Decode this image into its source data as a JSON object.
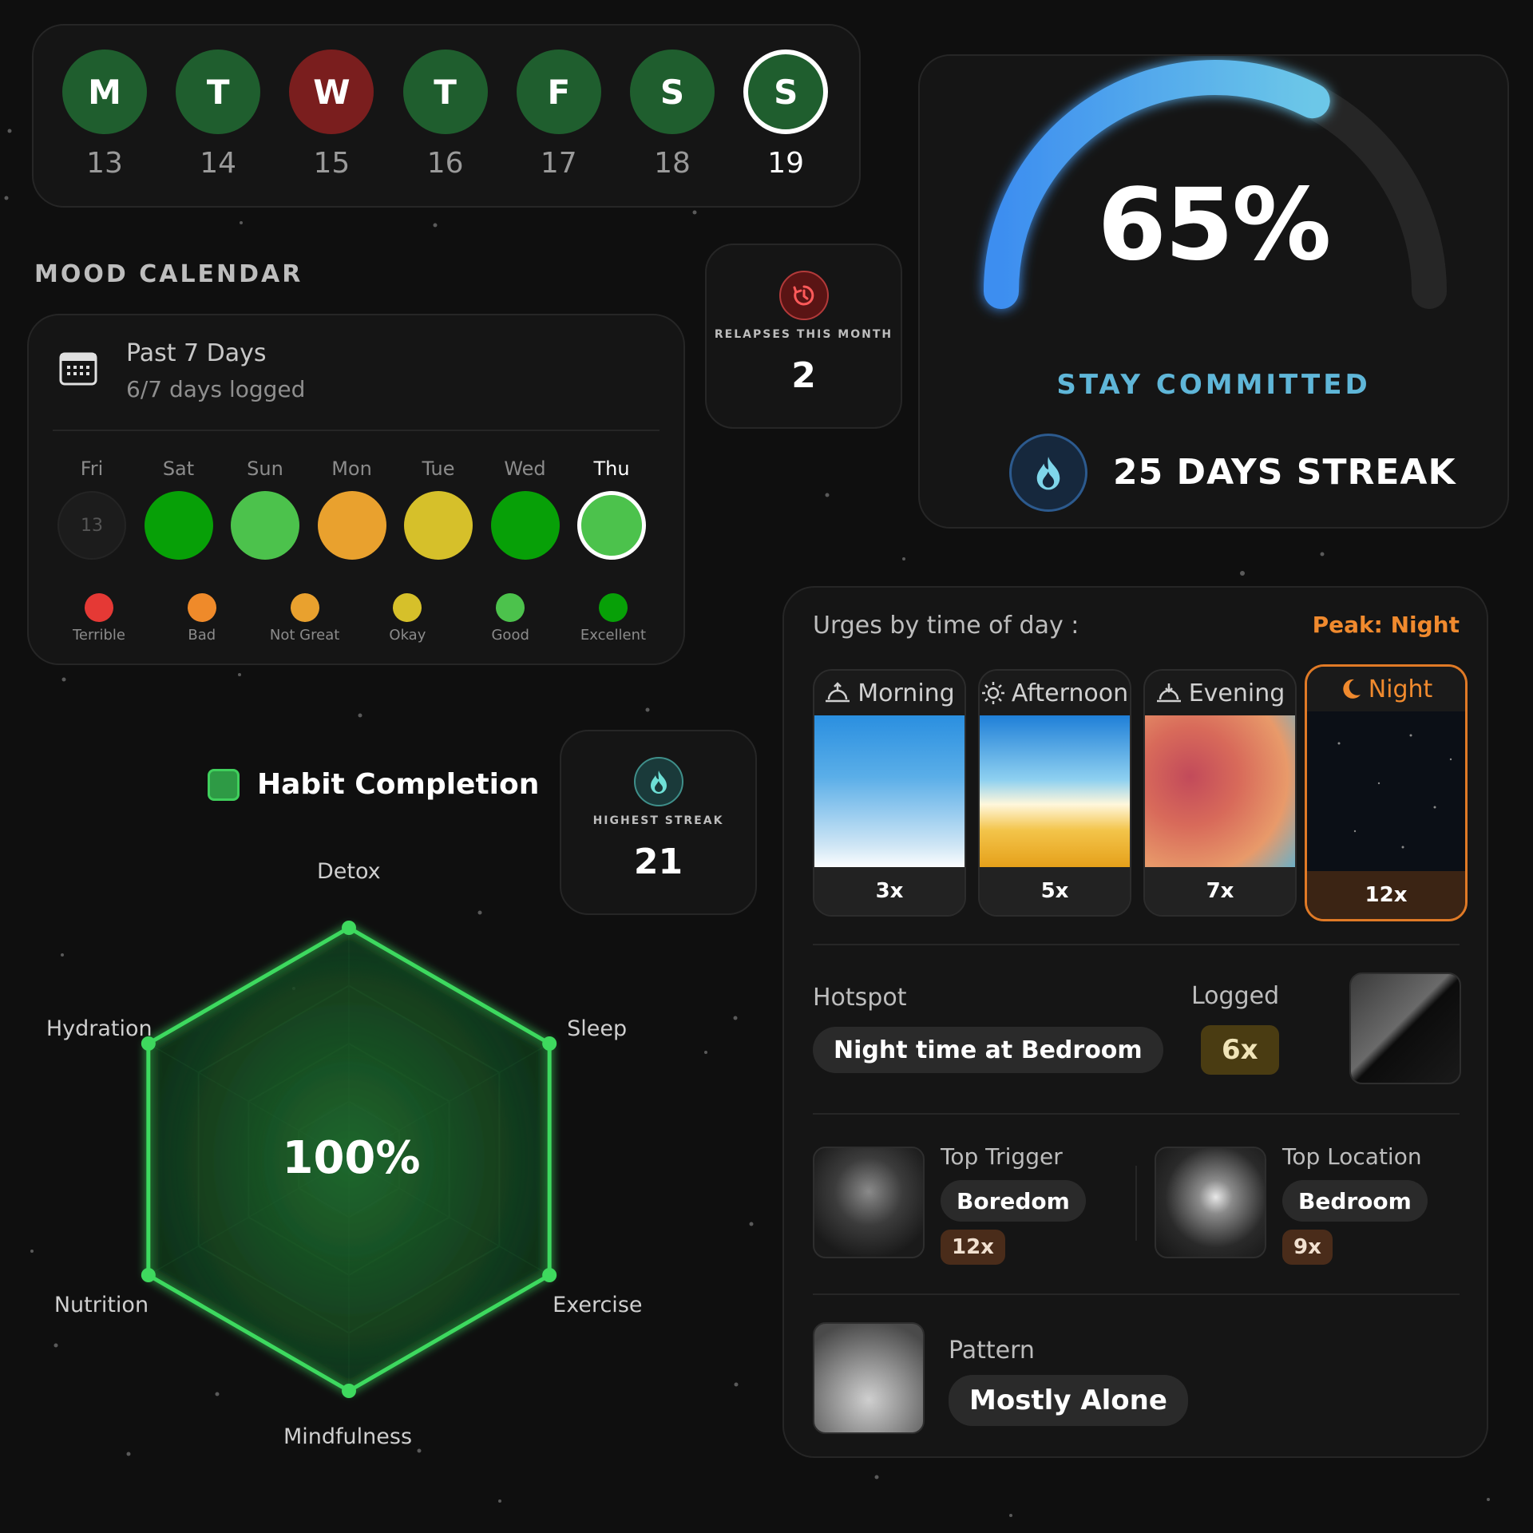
{
  "week": {
    "days": [
      {
        "letter": "M",
        "num": "13",
        "state": "done"
      },
      {
        "letter": "T",
        "num": "14",
        "state": "done"
      },
      {
        "letter": "W",
        "num": "15",
        "state": "missed"
      },
      {
        "letter": "T",
        "num": "16",
        "state": "done"
      },
      {
        "letter": "F",
        "num": "17",
        "state": "done"
      },
      {
        "letter": "S",
        "num": "18",
        "state": "done"
      },
      {
        "letter": "S",
        "num": "19",
        "state": "today"
      }
    ]
  },
  "mood": {
    "heading": "MOOD CALENDAR",
    "title": "Past 7 Days",
    "subtitle": "6/7 days logged",
    "days": [
      {
        "label": "Fri",
        "mood": "none",
        "value": "13"
      },
      {
        "label": "Sat",
        "mood": "Excellent"
      },
      {
        "label": "Sun",
        "mood": "Good"
      },
      {
        "label": "Mon",
        "mood": "Not Great"
      },
      {
        "label": "Tue",
        "mood": "Okay"
      },
      {
        "label": "Wed",
        "mood": "Excellent"
      },
      {
        "label": "Thu",
        "mood": "Good"
      }
    ],
    "legend": [
      {
        "label": "Terrible",
        "color": "#e53935"
      },
      {
        "label": "Bad",
        "color": "#ef8a2a"
      },
      {
        "label": "Not Great",
        "color": "#e9a12e"
      },
      {
        "label": "Okay",
        "color": "#d6c02a"
      },
      {
        "label": "Good",
        "color": "#4cc24c"
      },
      {
        "label": "Excellent",
        "color": "#07a007"
      }
    ]
  },
  "relapses": {
    "label": "RELAPSES THIS MONTH",
    "value": "2",
    "icon": "relapse-icon"
  },
  "highest": {
    "label": "HIGHEST STREAK",
    "value": "21",
    "icon": "flame-icon"
  },
  "progress": {
    "value": "65%",
    "fraction": 0.65,
    "motto": "STAY COMMITTED",
    "streak": "25 DAYS STREAK",
    "icon": "flame-icon"
  },
  "habit": {
    "title": "Habit Completion",
    "center": "100%",
    "axes": [
      "Detox",
      "Sleep",
      "Exercise",
      "Mindfulness",
      "Nutrition",
      "Hydration"
    ],
    "values": [
      1,
      1,
      1,
      1,
      1,
      1
    ]
  },
  "urges": {
    "title": "Urges by time of day :",
    "peak": "Peak: Night",
    "slots": [
      {
        "label": "Morning",
        "count": "3x",
        "icon": "sunrise-icon"
      },
      {
        "label": "Afternoon",
        "count": "5x",
        "icon": "sun-icon"
      },
      {
        "label": "Evening",
        "count": "7x",
        "icon": "sunset-icon"
      },
      {
        "label": "Night",
        "count": "12x",
        "icon": "moon-icon"
      }
    ],
    "hotspot_label": "Hotspot",
    "hotspot_value": "Night time at Bedroom",
    "logged_label": "Logged",
    "logged_value": "6x",
    "trigger_label": "Top Trigger",
    "trigger_value": "Boredom",
    "trigger_count": "12x",
    "location_label": "Top Location",
    "location_value": "Bedroom",
    "location_count": "9x",
    "pattern_label": "Pattern",
    "pattern_value": "Mostly Alone"
  }
}
